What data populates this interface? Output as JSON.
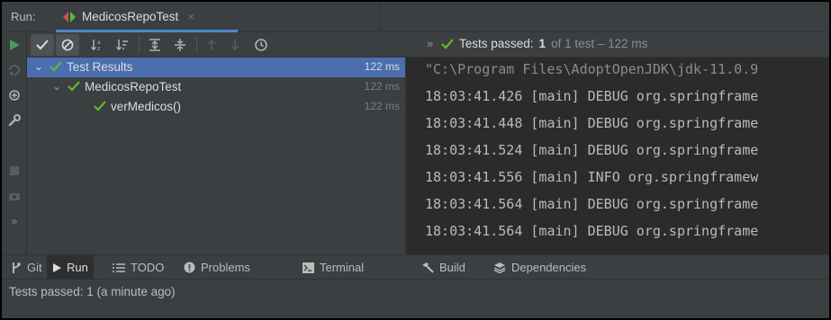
{
  "run_header": {
    "label": "Run:",
    "tab_title": "MedicosRepoTest",
    "close_glyph": "×"
  },
  "toolbar": {
    "buttons": [
      "rerun-icon",
      "show-passed-icon",
      "show-ignored-icon",
      "sort-alpha-icon",
      "sort-duration-icon",
      "expand-all-icon",
      "collapse-all-icon",
      "prev-failed-icon",
      "next-failed-icon",
      "history-icon"
    ],
    "more_glyph": "»",
    "status_prefix": "Tests passed:",
    "status_count": "1",
    "status_rest": "of 1 test – 122 ms"
  },
  "left_toolbar": {
    "buttons": [
      "run-icon",
      "rerun-failed-icon",
      "toggle-autotest-icon",
      "settings-wrench-icon",
      "stop-icon",
      "camera-icon",
      "more-icon"
    ]
  },
  "tree": {
    "rows": [
      {
        "label": "Test Results",
        "time": "122 ms"
      },
      {
        "label": "MedicosRepoTest",
        "time": "122 ms"
      },
      {
        "label": "verMedicos()",
        "time": "122 ms"
      }
    ]
  },
  "console": {
    "lines": [
      "\"C:\\Program Files\\AdoptOpenJDK\\jdk-11.0.9",
      "18:03:41.426 [main] DEBUG org.springframe",
      "18:03:41.448 [main] DEBUG org.springframe",
      "18:03:41.524 [main] DEBUG org.springframe",
      "18:03:41.556 [main] INFO org.springframew",
      "18:03:41.564 [main] DEBUG org.springframe",
      "18:03:41.564 [main] DEBUG org.springframe"
    ]
  },
  "tool_windows": {
    "items": [
      {
        "label": "Git",
        "icon": "git-icon"
      },
      {
        "label": "Run",
        "icon": "run-icon"
      },
      {
        "label": "TODO",
        "icon": "todo-list-icon"
      },
      {
        "label": "Problems",
        "icon": "problems-icon"
      },
      {
        "label": "Terminal",
        "icon": "terminal-icon"
      },
      {
        "label": "Build",
        "icon": "build-hammer-icon"
      },
      {
        "label": "Dependencies",
        "icon": "dependencies-icon"
      }
    ]
  },
  "status_bar": {
    "text": "Tests passed: 1 (a minute ago)"
  },
  "colors": {
    "selection": "#4b6eaf",
    "accent_underline": "#4a88c7",
    "pass_green": "#5fb832",
    "run_green": "#499c54",
    "panel": "#3c3f41",
    "editor": "#2b2b2b"
  }
}
